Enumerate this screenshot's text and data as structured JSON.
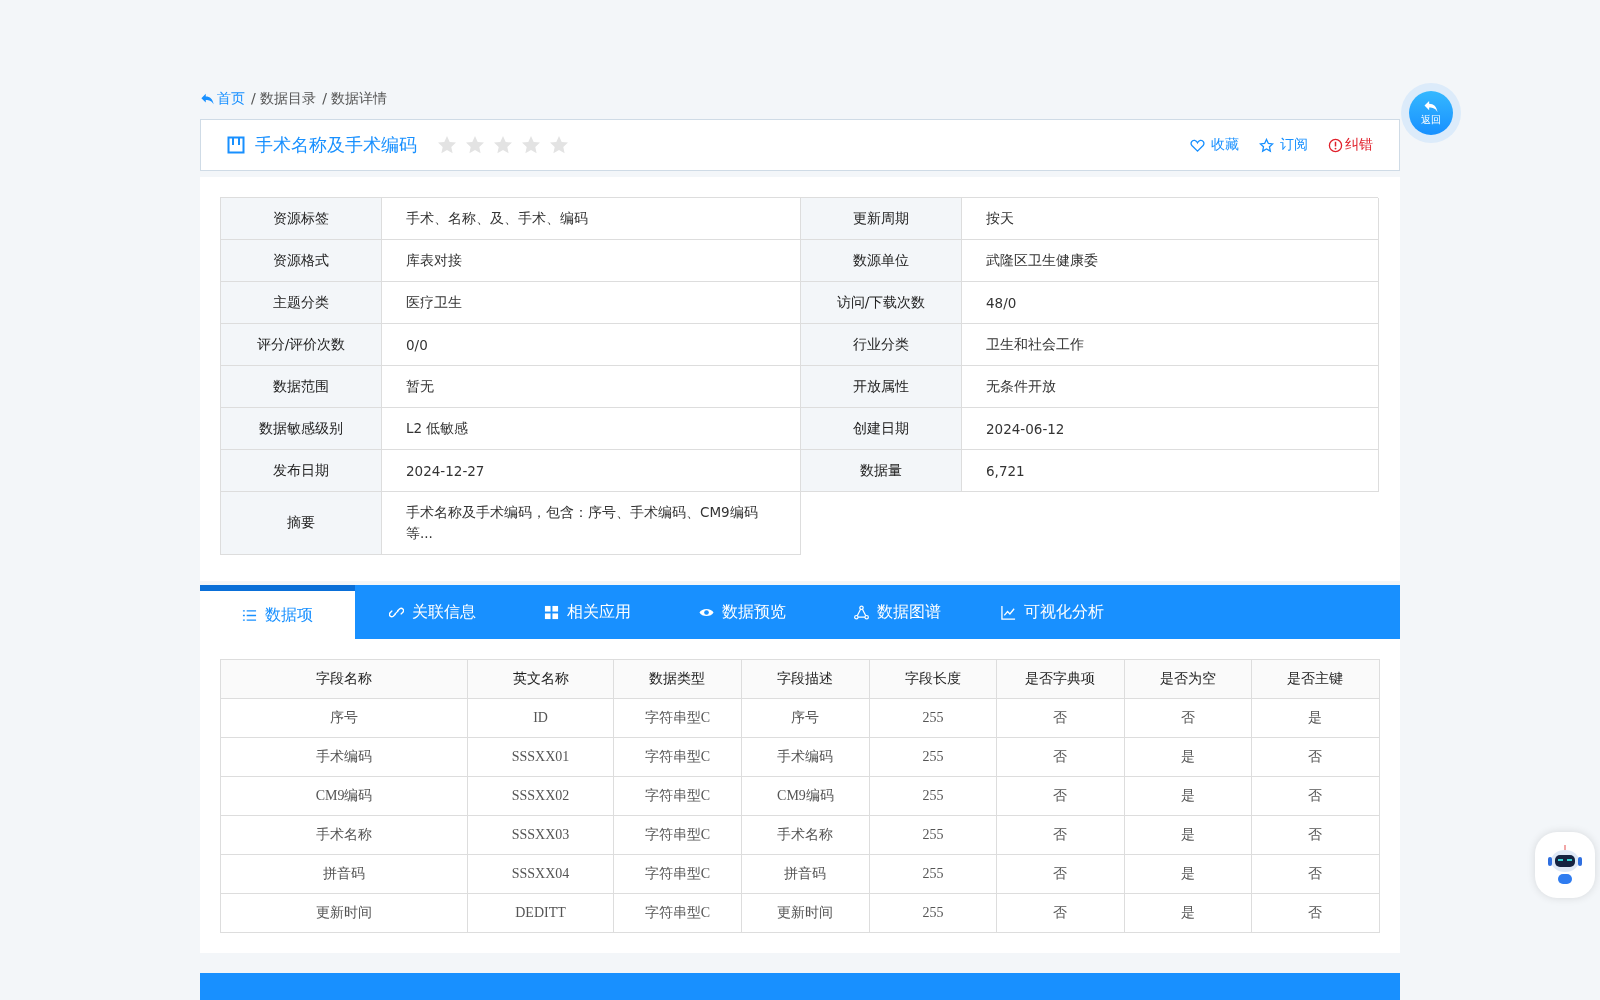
{
  "breadcrumb": [
    {
      "label": "首页",
      "kind": "home"
    },
    {
      "label": "/ 数据目录",
      "kind": "link"
    },
    {
      "label": "/ 数据详情",
      "kind": "current"
    }
  ],
  "title": {
    "text": "手术名称及手术编码",
    "stars": 0
  },
  "actions": [
    {
      "label": "收藏",
      "kind": "heart"
    },
    {
      "label": "订阅",
      "kind": "star"
    },
    {
      "label": "纠错",
      "kind": "error"
    }
  ],
  "info": [
    {
      "label": "资源标签",
      "value": "手术、名称、及、手术、编码"
    },
    {
      "label": "更新周期",
      "value": "按天"
    },
    {
      "label": "资源格式",
      "value": "库表对接"
    },
    {
      "label": "数源单位",
      "value": "武隆区卫生健康委"
    },
    {
      "label": "主题分类",
      "value": "医疗卫生"
    },
    {
      "label": "访问/下载次数",
      "value": "48/0"
    },
    {
      "label": "评分/评价次数",
      "value": "0/0"
    },
    {
      "label": "行业分类",
      "value": "卫生和社会工作"
    },
    {
      "label": "数据范围",
      "value": "暂无"
    },
    {
      "label": "开放属性",
      "value": "无条件开放"
    },
    {
      "label": "数据敏感级别",
      "value": "L2 低敏感"
    },
    {
      "label": "创建日期",
      "value": "2024-06-12"
    },
    {
      "label": "发布日期",
      "value": "2024-12-27"
    },
    {
      "label": "数据量",
      "value": "6,721"
    },
    {
      "label": "摘要",
      "value": "手术名称及手术编码，包含：序号、手术编码、CM9编码等..."
    }
  ],
  "tabs": [
    {
      "label": "数据项",
      "kind": "list",
      "selected": true
    },
    {
      "label": "关联信息",
      "kind": "link",
      "selected": false
    },
    {
      "label": "相关应用",
      "kind": "grid",
      "selected": false
    },
    {
      "label": "数据预览",
      "kind": "eye",
      "selected": false
    },
    {
      "label": "数据图谱",
      "kind": "graph",
      "selected": false
    },
    {
      "label": "可视化分析",
      "kind": "chart",
      "selected": false
    }
  ],
  "table": {
    "columns": [
      "字段名称",
      "英文名称",
      "数据类型",
      "字段描述",
      "字段长度",
      "是否字典项",
      "是否为空",
      "是否主键"
    ],
    "rows": [
      [
        "序号",
        "ID",
        "字符串型C",
        "序号",
        "255",
        "否",
        "否",
        "是"
      ],
      [
        "手术编码",
        "SSSXX01",
        "字符串型C",
        "手术编码",
        "255",
        "否",
        "是",
        "否"
      ],
      [
        "CM9编码",
        "SSSXX02",
        "字符串型C",
        "CM9编码",
        "255",
        "否",
        "是",
        "否"
      ],
      [
        "手术名称",
        "SSSXX03",
        "字符串型C",
        "手术名称",
        "255",
        "否",
        "是",
        "否"
      ],
      [
        "拼音码",
        "SSSXX04",
        "字符串型C",
        "拼音码",
        "255",
        "否",
        "是",
        "否"
      ],
      [
        "更新时间",
        "DEDITT",
        "字符串型C",
        "更新时间",
        "255",
        "否",
        "是",
        "否"
      ]
    ]
  },
  "back_button": {
    "label": "返回"
  }
}
